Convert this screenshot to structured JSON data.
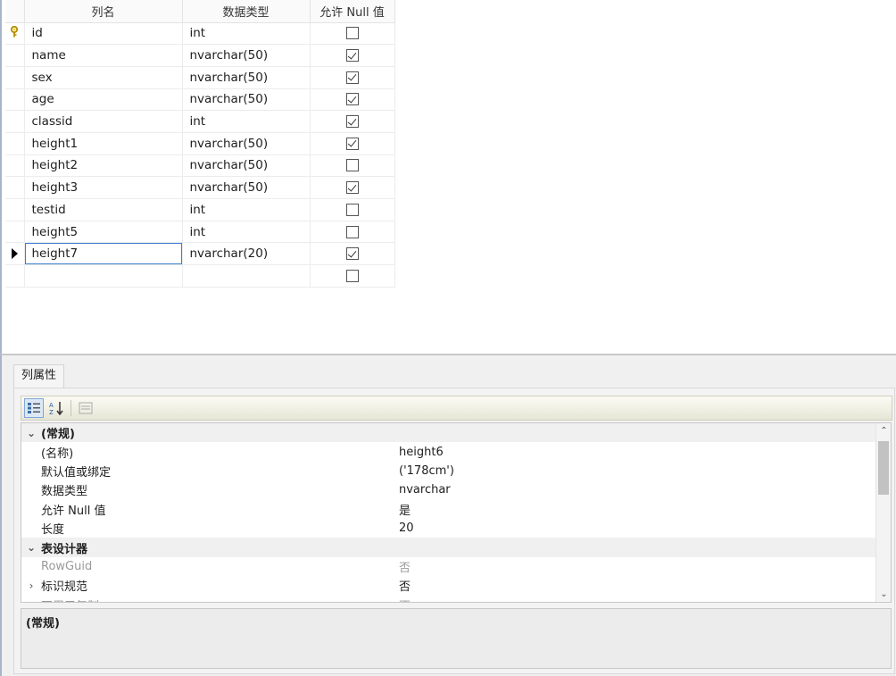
{
  "grid": {
    "headers": [
      "列名",
      "数据类型",
      "允许 Null 值"
    ],
    "rows": [
      {
        "name": "id",
        "type": "int",
        "allow_null": false,
        "primary_key": true
      },
      {
        "name": "name",
        "type": "nvarchar(50)",
        "allow_null": true
      },
      {
        "name": "sex",
        "type": "nvarchar(50)",
        "allow_null": true
      },
      {
        "name": "age",
        "type": "nvarchar(50)",
        "allow_null": true
      },
      {
        "name": "classid",
        "type": "int",
        "allow_null": true
      },
      {
        "name": "height1",
        "type": "nvarchar(50)",
        "allow_null": true
      },
      {
        "name": "height2",
        "type": "nvarchar(50)",
        "allow_null": false
      },
      {
        "name": "height3",
        "type": "nvarchar(50)",
        "allow_null": true
      },
      {
        "name": "testid",
        "type": "int",
        "allow_null": false
      },
      {
        "name": "height5",
        "type": "int",
        "allow_null": false
      },
      {
        "name": "height7",
        "type": "nvarchar(20)",
        "allow_null": true,
        "current": true,
        "editing": true
      },
      {
        "name": "",
        "type": "",
        "allow_null": false
      }
    ]
  },
  "props": {
    "tab_label": "列属性",
    "toolbar": {
      "categorized_icon": "categorized-icon",
      "alphabetical_icon": "sort-az-icon",
      "property_pages_icon": "property-pages-icon"
    },
    "rows": [
      {
        "kind": "cat",
        "toggle": "expanded",
        "name": "(常规)",
        "value": ""
      },
      {
        "kind": "prop",
        "toggle": "",
        "name": "(名称)",
        "value": "height6"
      },
      {
        "kind": "prop",
        "toggle": "",
        "name": "默认值或绑定",
        "value": "('178cm')"
      },
      {
        "kind": "prop",
        "toggle": "",
        "name": "数据类型",
        "value": "nvarchar"
      },
      {
        "kind": "prop",
        "toggle": "",
        "name": "允许 Null 值",
        "value": "是"
      },
      {
        "kind": "prop",
        "toggle": "",
        "name": "长度",
        "value": "20"
      },
      {
        "kind": "cat",
        "toggle": "expanded",
        "name": "表设计器",
        "value": ""
      },
      {
        "kind": "prop",
        "toggle": "",
        "name": "RowGuid",
        "value": "否",
        "dim": true
      },
      {
        "kind": "prop",
        "toggle": "collapsed",
        "name": "标识规范",
        "value": "否"
      },
      {
        "kind": "prop",
        "toggle": "",
        "name": "不用于复制",
        "value": "否",
        "dim": true
      }
    ],
    "description": "(常规)"
  }
}
